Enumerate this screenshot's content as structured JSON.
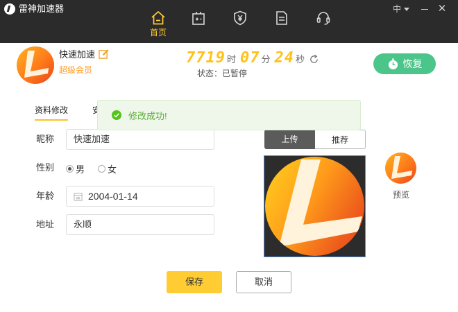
{
  "app": {
    "title": "雷神加速器"
  },
  "window": {
    "language": "中",
    "close_glyph": "✕"
  },
  "nav": {
    "tabs": [
      {
        "label": "首页",
        "icon": "home-icon",
        "active": true
      },
      {
        "label": "",
        "icon": "game-controller-icon"
      },
      {
        "label": "",
        "icon": "shield-yen-icon"
      },
      {
        "label": "",
        "icon": "document-icon"
      },
      {
        "label": "",
        "icon": "headset-icon"
      }
    ]
  },
  "user": {
    "name": "快速加速",
    "badge": "超级会员",
    "edit_icon": "pencil-icon"
  },
  "timer": {
    "hours": "7719",
    "hours_unit": "时",
    "minutes": "07",
    "minutes_unit": "分",
    "seconds": "24",
    "seconds_unit": "秒",
    "status": "状态：已暂停"
  },
  "resume_button": {
    "label": "恢复",
    "icon": "stopwatch-icon"
  },
  "tabs": {
    "profile": "资料修改",
    "security": "安"
  },
  "toast": {
    "text": "修改成功!",
    "icon": "check-circle-icon"
  },
  "form": {
    "nickname_label": "昵称",
    "nickname_value": "快速加速",
    "gender_label": "性别",
    "gender_male": "男",
    "gender_female": "女",
    "gender_selected": "男",
    "age_label": "年龄",
    "birthdate": "2004-01-14",
    "address_label": "地址",
    "address_value": "永顺"
  },
  "upload": {
    "upload_label": "上传",
    "recommend_label": "推荐",
    "preview_label": "预览"
  },
  "actions": {
    "save": "保存",
    "cancel": "取消"
  },
  "colors": {
    "accent_yellow": "#ffc21a",
    "green": "#4cc58a",
    "topbar": "#2b2b2b",
    "toast_text": "#5cae3a"
  }
}
